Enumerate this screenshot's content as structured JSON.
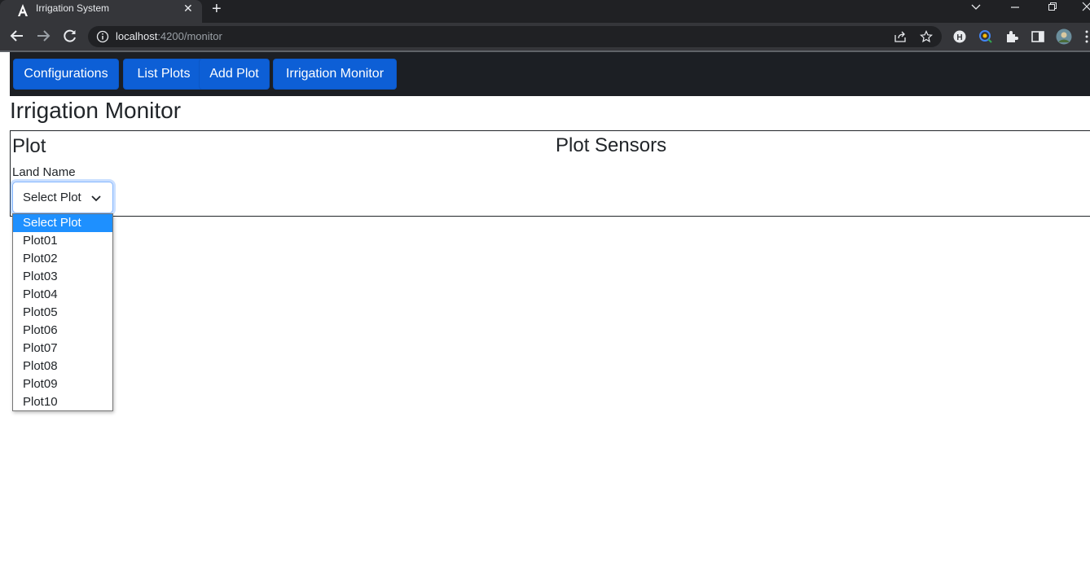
{
  "browser": {
    "tab_title": "Irrigation System",
    "url_host": "localhost",
    "url_path": ":4200/monitor"
  },
  "nav": {
    "buttons": [
      {
        "label": "Configurations"
      },
      {
        "label": "List Plots"
      },
      {
        "label": "Add Plot"
      },
      {
        "label": "Irrigation Monitor"
      }
    ]
  },
  "page": {
    "title": "Irrigation Monitor",
    "plot_heading": "Plot",
    "sensors_heading": "Plot Sensors",
    "land_label": "Land Name",
    "select_value": "Select Plot"
  },
  "dropdown": {
    "options": [
      "Select Plot",
      "Plot01",
      "Plot02",
      "Plot03",
      "Plot04",
      "Plot05",
      "Plot06",
      "Plot07",
      "Plot08",
      "Plot09",
      "Plot10"
    ],
    "highlighted": "Select Plot"
  },
  "colors": {
    "nav_button": "#0d5fd6",
    "highlight": "#1e90ff",
    "nav_bar": "#1c1f24"
  }
}
